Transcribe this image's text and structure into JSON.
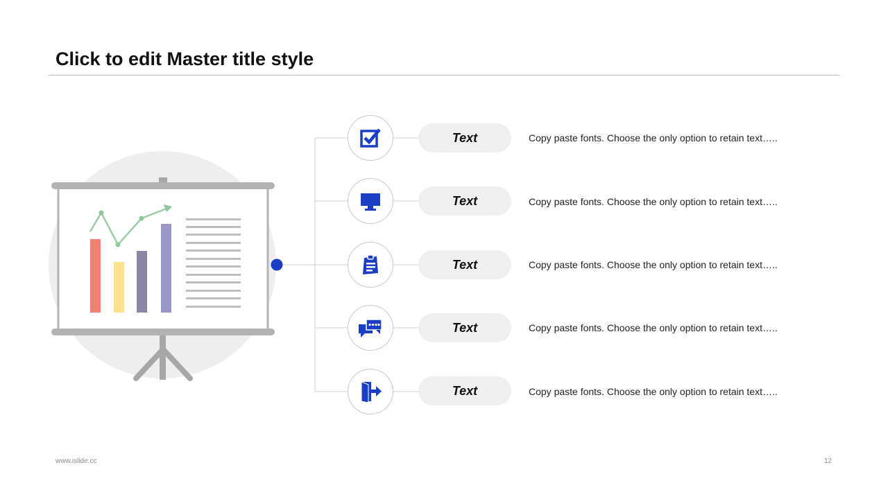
{
  "slide": {
    "title": "Click to edit Master title style",
    "footer_url": "www.islide.cc",
    "page_number": "12"
  },
  "accent_color": "#1a3fc4",
  "items": [
    {
      "icon": "checkbox-icon",
      "label": "Text",
      "description": "Copy paste fonts. Choose the only option to retain text….."
    },
    {
      "icon": "monitor-icon",
      "label": "Text",
      "description": "Copy paste fonts. Choose the only option to retain text….."
    },
    {
      "icon": "clipboard-icon",
      "label": "Text",
      "description": "Copy paste fonts. Choose the only option to retain text….."
    },
    {
      "icon": "chat-icon",
      "label": "Text",
      "description": "Copy paste fonts. Choose the only option to retain text….."
    },
    {
      "icon": "exit-door-icon",
      "label": "Text",
      "description": "Copy paste fonts. Choose the only option to retain text….."
    }
  ]
}
